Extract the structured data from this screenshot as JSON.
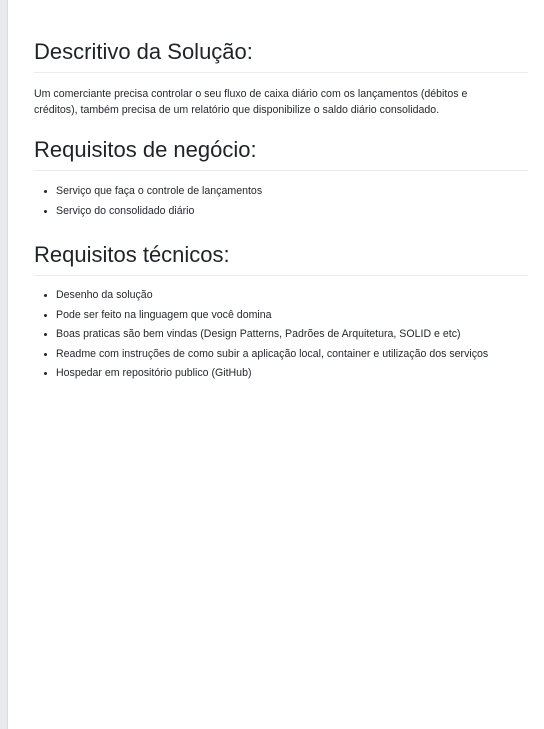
{
  "sections": [
    {
      "title": "Descritivo da Solução:",
      "paragraph": "Um comerciante precisa controlar o seu fluxo de caixa diário com os lançamentos (débitos e créditos), também precisa de um relatório que disponibilize o saldo diário consolidado."
    },
    {
      "title": "Requisitos de negócio:",
      "items": [
        "Serviço que faça o controle de lançamentos",
        "Serviço do consolidado diário"
      ]
    },
    {
      "title": "Requisitos técnicos:",
      "items": [
        "Desenho da solução",
        "Pode ser feito na linguagem que você domina",
        "Boas praticas são bem vindas (Design Patterns, Padrões de Arquitetura, SOLID e etc)",
        "Readme com instruções de como subir a aplicação local, container e utilização dos serviços",
        "Hospedar em repositório publico (GitHub)"
      ]
    }
  ]
}
